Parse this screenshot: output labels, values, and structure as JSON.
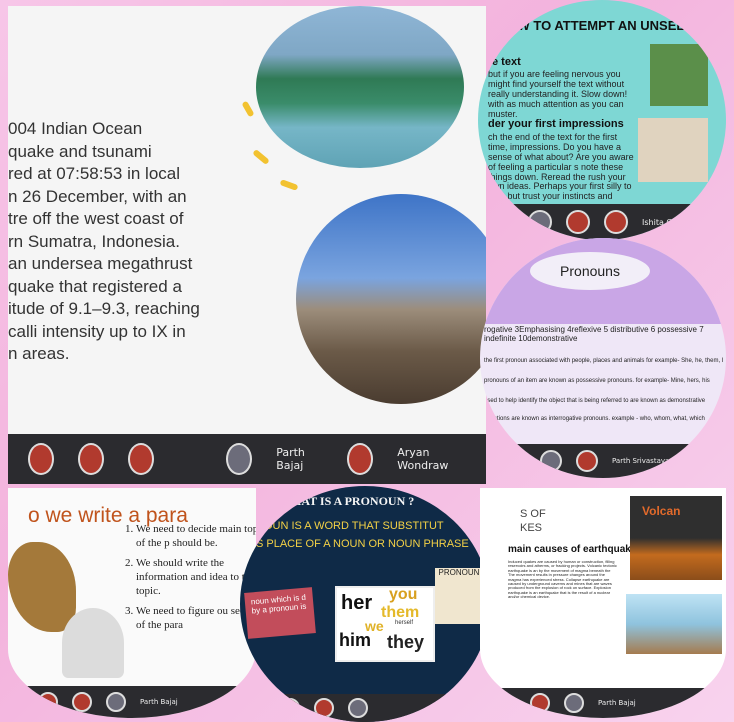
{
  "collage": {
    "top_left_slide": {
      "text_lines": [
        "004 Indian Ocean",
        "quake and tsunami",
        "red at 07:58:53 in local",
        "n 26 December, with an",
        "tre off the west coast of",
        "rn Sumatra, Indonesia.",
        "an undersea megathrust",
        "quake that registered a",
        "itude of 9.1–9.3, reaching",
        "calli intensity up to IX in",
        "n areas."
      ],
      "participants": [
        "Parth Bajaj",
        "Aryan Wondraw"
      ]
    },
    "top_right_slide": {
      "title": "HOW TO ATTEMPT AN UNSEEN PROSE",
      "section1_title": "e text",
      "section1_body": "but if you are feeling nervous you might find yourself the text without really understanding it. Slow down! with as much attention as you can muster.",
      "section2_title": "der your first impressions",
      "section2_body": "ch the end of the text for the first time, impressions. Do you have a sense of what about? Are you aware of feeling a particular s note these things down. Reread the rush your own ideas. Perhaps your first silly to you, but trust your instincts and",
      "participant": "Ishita Gupta"
    },
    "mid_right_slide": {
      "title": "Pronouns",
      "list": "rogative 3Emphasising 4reflexive 5 distributive 6 possessive 7 indefinite 10demonstrative",
      "line1": "the first pronoun associated with people, places and animals for example- She, he, them, I",
      "line2": "pronouns of an item are known as possessive pronouns. for example- Mine, hers, his",
      "line3": "used to help identify the object that is being referred to are known as demonstrative",
      "line4": "questions are known as interrogative pronouns. example - who, whom, what, which",
      "participant": "Parth Srivastava"
    },
    "bottom_left_slide": {
      "title": "o we write a para",
      "steps": [
        "We need to decide main topic of the p should be.",
        "We should write the information and idea to that topic.",
        "We need to figure ou sequence of the para"
      ],
      "participant": "Parth Bajaj"
    },
    "bottom_middle_slide": {
      "title": "WHAT IS A PRONOUN ?",
      "subtitle1": "NOUN IS A WORD THAT SUBSTITUT",
      "subtitle2": "S PLACE OF A NOUN OR NOUN PHRASE",
      "note": "noun which is d by a pronoun is",
      "tag": "PRONOUN",
      "words": [
        "her",
        "you",
        "them",
        "herself",
        "we",
        "him",
        "they"
      ]
    },
    "bottom_right_slide": {
      "title1": "S OF",
      "title2": "KES",
      "subtitle": "main causes of earthquakes",
      "body": "Induced quakes are caused by human or construction, filling reservoirs and atherms, or fracking projects. Volcanic tectonic earthquake is an by the movement of magma beneath the The movement results in pressure changes around the magma has experienced stress. Collapse earthquake are caused by underground caverns and mines that are waves produced from the explosion of rock on surface. Explosion earthquake is an earthquake that is the result of a nuclear and/or chemical device.",
      "volcano_label": "Volcan",
      "participant": "Parth Bajaj"
    }
  },
  "colors": {
    "background": "#f5bfe3",
    "teal_slide": "#7ed7d4",
    "dark_bar": "#2b2b2f"
  }
}
